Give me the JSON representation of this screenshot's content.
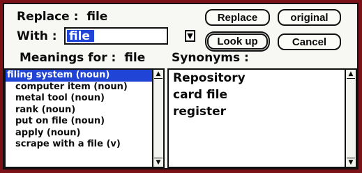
{
  "replace": {
    "label": "Replace :",
    "word": "file"
  },
  "with": {
    "label": "With :",
    "value": "file",
    "popup_icon": "triangle-down-icon"
  },
  "buttons": {
    "replace": "Replace",
    "original": "original",
    "lookup": "Look up",
    "cancel": "Cancel"
  },
  "meanings": {
    "label": "Meanings for :",
    "word": "file",
    "items": [
      "filing system (noun)",
      "computer item (noun)",
      "metal tool (noun)",
      "rank (noun)",
      "put on file (noun)",
      "apply (noun)",
      "scrape with a file (v)"
    ],
    "selected_index": 0
  },
  "synonyms": {
    "label": "Synonyms :",
    "items": [
      "Repository",
      "card file",
      "register"
    ]
  }
}
